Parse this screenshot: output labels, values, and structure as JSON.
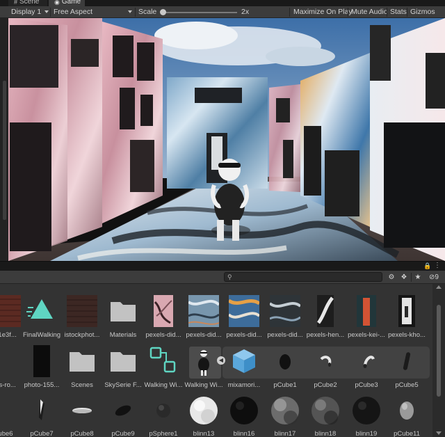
{
  "tabs": [
    {
      "label": "Scene",
      "icon": "grid-icon"
    },
    {
      "label": "Game",
      "icon": "gamepad-icon"
    }
  ],
  "game_toolbar": {
    "display": "Display 1",
    "aspect": "Free Aspect",
    "scale_label": "Scale",
    "scale_value": "2x",
    "scale_fraction": 0.02,
    "maximize": "Maximize On Play",
    "mute": "Mute Audio",
    "stats": "Stats",
    "gizmos": "Gizmos"
  },
  "project_toolbar": {
    "search_value": "",
    "hidden_count": "9"
  },
  "assets": {
    "row1": [
      {
        "label": "e1e3f...",
        "kind": "brick"
      },
      {
        "label": "FinalWalking",
        "kind": "anim"
      },
      {
        "label": "istockphot...",
        "kind": "brickdark"
      },
      {
        "label": "Materials",
        "kind": "folder"
      },
      {
        "label": "pexels-did...",
        "kind": "pinkmarble"
      },
      {
        "label": "pexels-did...",
        "kind": "bluemarble"
      },
      {
        "label": "pexels-did...",
        "kind": "orangemarble"
      },
      {
        "label": "pexels-did...",
        "kind": "darkmarble"
      },
      {
        "label": "pexels-hen...",
        "kind": "bwmarble"
      },
      {
        "label": "pexels-kei-...",
        "kind": "redstripe"
      },
      {
        "label": "pexels-kho...",
        "kind": "door"
      }
    ],
    "row2": [
      {
        "label": "es-ro...",
        "kind": "greybox"
      },
      {
        "label": "photo-155...",
        "kind": "black"
      },
      {
        "label": "Scenes",
        "kind": "folder"
      },
      {
        "label": "SkySerie F...",
        "kind": "folder"
      },
      {
        "label": "Walking Wi...",
        "kind": "prefab"
      },
      {
        "label": "Walking Wi...",
        "kind": "character"
      },
      {
        "label": "mixamori...",
        "kind": "cube3d"
      },
      {
        "label": "pCube1",
        "kind": "egg"
      },
      {
        "label": "pCube2",
        "kind": "hook"
      },
      {
        "label": "pCube3",
        "kind": "hook2"
      },
      {
        "label": "pCube5",
        "kind": "stick"
      }
    ],
    "row3": [
      {
        "label": "ube6",
        "kind": "dark-blob"
      },
      {
        "label": "pCube7",
        "kind": "shard"
      },
      {
        "label": "pCube8",
        "kind": "disc"
      },
      {
        "label": "pCube9",
        "kind": "ellipse-dark"
      },
      {
        "label": "pSphere1",
        "kind": "small-sphere"
      },
      {
        "label": "blinn13",
        "kind": "sphere-white"
      },
      {
        "label": "blinn16",
        "kind": "sphere-black"
      },
      {
        "label": "blinn17",
        "kind": "sphere-grey"
      },
      {
        "label": "blinn18",
        "kind": "sphere-grey2"
      },
      {
        "label": "blinn19",
        "kind": "sphere-black2"
      },
      {
        "label": "pCube11",
        "kind": "egg-grey"
      }
    ]
  }
}
